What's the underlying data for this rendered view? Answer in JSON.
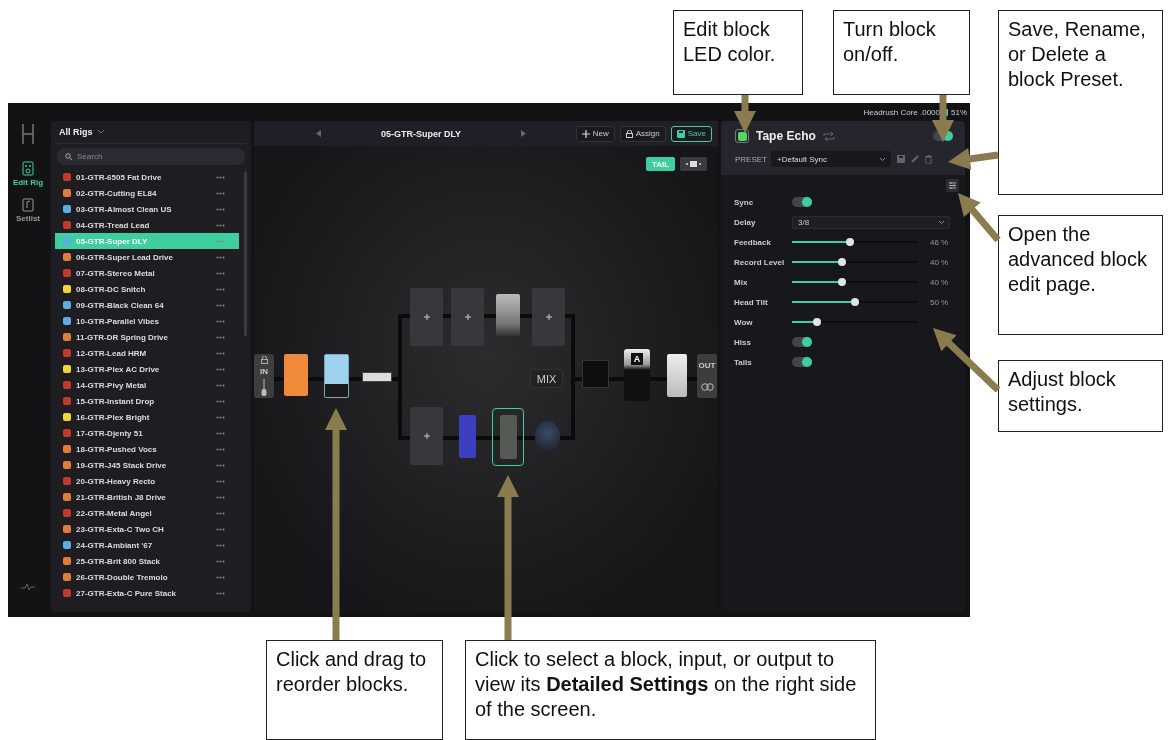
{
  "app": {
    "status": {
      "device": "Headrush Core .0000",
      "battery": "51%"
    },
    "nav": [
      {
        "label": "Edit Rig",
        "selected": true
      },
      {
        "label": "Setlist",
        "selected": false
      }
    ],
    "rig_list": {
      "filter": "All Rigs",
      "search": {
        "placeholder": "Search"
      },
      "items": [
        {
          "name": "01-GTR-6505 Fat Drive",
          "color": "#c0392b",
          "selected": false
        },
        {
          "name": "02-GTR-Cutting EL84",
          "color": "#e07b39",
          "selected": false
        },
        {
          "name": "03-GTR-Almost Clean US",
          "color": "#5aaee0",
          "selected": false
        },
        {
          "name": "04-GTR-Tread Lead",
          "color": "#c0392b",
          "selected": false
        },
        {
          "name": "05-GTR-Super DLY",
          "color": "#5aaee0",
          "selected": true
        },
        {
          "name": "06-GTR-Super Lead Drive",
          "color": "#e07b39",
          "selected": false
        },
        {
          "name": "07-GTR-Stereo Metal",
          "color": "#c0392b",
          "selected": false
        },
        {
          "name": "08-GTR-DC Snitch",
          "color": "#f0d43a",
          "selected": false
        },
        {
          "name": "09-GTR-Black Clean 64",
          "color": "#5aaee0",
          "selected": false
        },
        {
          "name": "10-GTR-Parallel Vibes",
          "color": "#5aaee0",
          "selected": false
        },
        {
          "name": "11-GTR-DR Spring Drive",
          "color": "#e07b39",
          "selected": false
        },
        {
          "name": "12-GTR-Lead HRM",
          "color": "#c0392b",
          "selected": false
        },
        {
          "name": "13-GTR-Plex AC Drive",
          "color": "#f0d43a",
          "selected": false
        },
        {
          "name": "14-GTR-Pivy Metal",
          "color": "#c0392b",
          "selected": false
        },
        {
          "name": "15-GTR-Instant Drop",
          "color": "#c0392b",
          "selected": false
        },
        {
          "name": "16-GTR-Plex Bright",
          "color": "#f0d43a",
          "selected": false
        },
        {
          "name": "17-GTR-Djenty 51",
          "color": "#c0392b",
          "selected": false
        },
        {
          "name": "18-GTR-Pushed Vocs",
          "color": "#e07b39",
          "selected": false
        },
        {
          "name": "19-GTR-J45 Stack Drive",
          "color": "#e07b39",
          "selected": false
        },
        {
          "name": "20-GTR-Heavy Recto",
          "color": "#c0392b",
          "selected": false
        },
        {
          "name": "21-GTR-British J8 Drive",
          "color": "#e07b39",
          "selected": false
        },
        {
          "name": "22-GTR-Metal Angel",
          "color": "#c0392b",
          "selected": false
        },
        {
          "name": "23-GTR-Exta-C Two CH",
          "color": "#e07b39",
          "selected": false
        },
        {
          "name": "24-GTR-Ambiant '67",
          "color": "#5aaee0",
          "selected": false
        },
        {
          "name": "25-GTR-Brit 800 Stack",
          "color": "#e07b39",
          "selected": false
        },
        {
          "name": "26-GTR-Double Tremolo",
          "color": "#e07b39",
          "selected": false
        },
        {
          "name": "27-GTR-Exta-C Pure Stack",
          "color": "#c0392b",
          "selected": false
        }
      ]
    },
    "rig_header": {
      "title": "05-GTR-Super DLY",
      "buttons": [
        {
          "label": "New",
          "kind": "new"
        },
        {
          "label": "Assign",
          "kind": "assign"
        },
        {
          "label": "Save",
          "kind": "save"
        }
      ]
    },
    "canvas": {
      "tail": {
        "label": "TAIL",
        "on": true
      },
      "input": "IN",
      "output": "OUT",
      "mix": "MIX",
      "pedal_letter": "A"
    },
    "block": {
      "name": "Tape Echo",
      "on": true,
      "preset_label": "PRESET",
      "preset": "+Default Sync",
      "params": [
        {
          "kind": "toggle",
          "label": "Sync",
          "on": true
        },
        {
          "kind": "select",
          "label": "Delay",
          "value": "3/8"
        },
        {
          "kind": "slider",
          "label": "Feedback",
          "level": 0.46,
          "reading": "46 %"
        },
        {
          "kind": "slider",
          "label": "Record Level",
          "level": 0.4,
          "reading": "40 %"
        },
        {
          "kind": "slider",
          "label": "Mix",
          "level": 0.4,
          "reading": "40 %"
        },
        {
          "kind": "slider",
          "label": "Head Tilt",
          "level": 0.5,
          "reading": "50 %"
        },
        {
          "kind": "slider",
          "label": "Wow",
          "level": 0.2
        },
        {
          "kind": "toggle",
          "label": "Hiss",
          "on": true
        },
        {
          "kind": "toggle",
          "label": "Tails",
          "on": true
        }
      ]
    }
  },
  "callouts": [
    {
      "text": "Edit block LED color."
    },
    {
      "text": "Turn block on/off."
    },
    {
      "text": "Save, Rename, or Delete a block Preset."
    },
    {
      "text": "Open the advanced block edit page."
    },
    {
      "text": "Adjust block settings."
    },
    {
      "text": "Click and drag to reorder blocks."
    },
    {
      "text": "Click to select a block, input, or output to view its **Detailed Settings** on the right side of the screen."
    }
  ]
}
